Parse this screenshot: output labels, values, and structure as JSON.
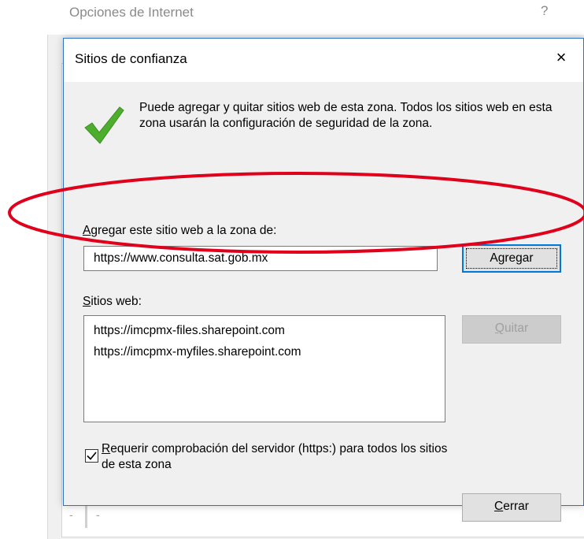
{
  "parent_window": {
    "title": "Opciones de Internet",
    "help": "?",
    "slider_ticks": [
      "-",
      "-"
    ]
  },
  "dialog": {
    "title": "Sitios de confianza",
    "close": "×",
    "intro": "Puede agregar y quitar sitios web de esta zona. Todos los sitios web en esta zona usarán la configuración de seguridad de la zona.",
    "add_label_key": "A",
    "add_label_rest": "gregar este sitio web a la zona de:",
    "url_value": "https://www.consulta.sat.gob.mx",
    "add_button_pre": "Agre",
    "add_button_key": "g",
    "add_button_post": "ar",
    "sites_label_key": "S",
    "sites_label_rest": "itios web:",
    "sites": [
      "https://imcpmx-files.sharepoint.com",
      "https://imcpmx-myfiles.sharepoint.com"
    ],
    "remove_button_key": "Q",
    "remove_button_rest": "uitar",
    "require_https_key": "R",
    "require_https_rest_1": "equerir comprobación del servidor (https:) para todos los sitios",
    "require_https_rest_2": "de esta zona",
    "require_https_checked": true,
    "close_button_key": "C",
    "close_button_rest": "errar"
  },
  "colors": {
    "annotation": "#e0001b",
    "accent": "#0078d7",
    "check": "#4cae2c"
  }
}
